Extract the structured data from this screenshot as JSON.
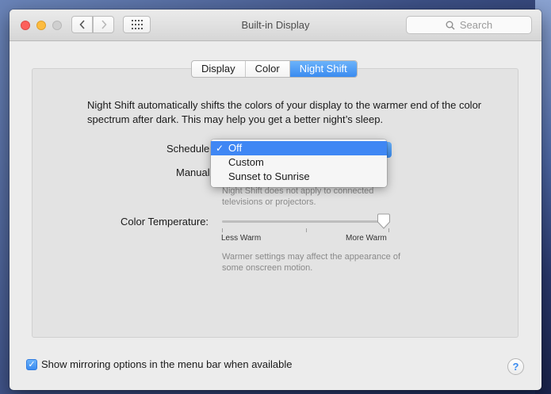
{
  "window": {
    "title": "Built-in Display"
  },
  "toolbar": {
    "search_placeholder": "Search",
    "back_icon": "‹",
    "forward_icon": "›"
  },
  "tabs": [
    {
      "label": "Display",
      "active": false
    },
    {
      "label": "Color",
      "active": false
    },
    {
      "label": "Night Shift",
      "active": true
    }
  ],
  "intro_text": "Night Shift automatically shifts the colors of your display to the warmer end of the color spectrum after dark. This may help you get a better night’s sleep.",
  "schedule": {
    "label": "Schedule",
    "options": [
      "Off",
      "Custom",
      "Sunset to Sunrise"
    ],
    "selected": "Off"
  },
  "manual": {
    "label": "Manual"
  },
  "notes": {
    "connected": "Night Shift does not apply to connected televisions or projectors.",
    "warmer": "Warmer settings may affect the appearance of some onscreen motion."
  },
  "color_temperature": {
    "label": "Color Temperature:",
    "less_label": "Less Warm",
    "more_label": "More Warm",
    "value": 1.0
  },
  "mirroring": {
    "label": "Show mirroring options in the menu bar when available",
    "checked": true
  },
  "colors": {
    "accent": "#3f87f4",
    "close": "#fc605c",
    "minimize": "#fdbc40"
  }
}
